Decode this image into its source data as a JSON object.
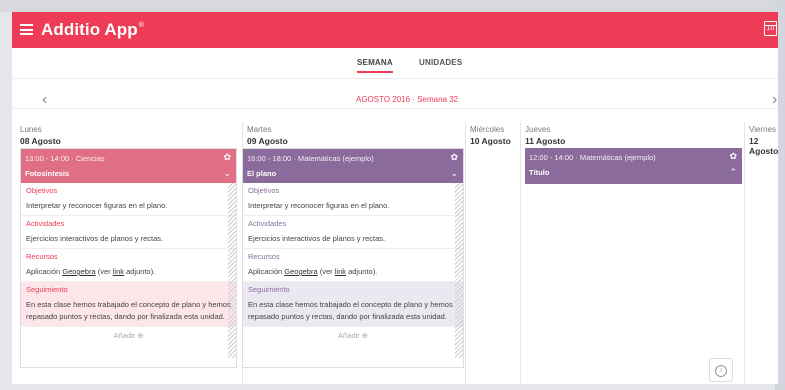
{
  "app": {
    "title": "Additio App",
    "trademark": "®",
    "calendar_badge": "10"
  },
  "tabs": [
    {
      "label": "SEMANA"
    },
    {
      "label": "UNIDADES"
    }
  ],
  "nav": {
    "prev": "‹",
    "next": "›",
    "period": "AGOSTO 2016 · Semana 32"
  },
  "days": [
    {
      "name": "Lunes",
      "date": "08 Agosto"
    },
    {
      "name": "Martes",
      "date": "09 Agosto"
    },
    {
      "name": "Miércoles",
      "date": "10 Agosto"
    },
    {
      "name": "Jueves",
      "date": "11 Agosto"
    },
    {
      "name": "Viernes",
      "date": "12 Agosto"
    }
  ],
  "cards": [
    {
      "time": "13:00 - 14:00  ·  Ciencias",
      "subtitle": "Fotosíntesis",
      "color": "#e06e85",
      "objetivos_label": "Objetivos",
      "objetivos": "Interpretar y reconocer figuras en el plano.",
      "actividades_label": "Actividades",
      "actividades": "Ejercicios interactivos de planos y rectas.",
      "recursos_label": "Recursos",
      "recursos_pre": "Aplicación ",
      "recursos_link1": "Geogebra",
      "recursos_mid": " (ver ",
      "recursos_link2": "link",
      "recursos_post": " adjunto).",
      "seguimiento_label": "Seguimiento",
      "seguimiento": "En esta clase hemos trabajado el concepto de plano y hemos repasado puntos y rectas, dando por finalizada esta unidad.",
      "add_label": "Añadir ⊕"
    },
    {
      "time": "16:00 - 18:00  ·  Matemáticas (ejemplo)",
      "subtitle": "El plano",
      "color": "#8b6a9c",
      "objetivos_label": "Objetivos",
      "objetivos": "Interpretar y reconocer figuras en el plano.",
      "actividades_label": "Actividades",
      "actividades": "Ejercicios interactivos de planos y rectas.",
      "recursos_label": "Recursos",
      "recursos_pre": "Aplicación ",
      "recursos_link1": "Geogebra",
      "recursos_mid": " (ver ",
      "recursos_link2": "link",
      "recursos_post": " adjunto).",
      "seguimiento_label": "Seguimiento",
      "seguimiento": "En esta clase hemos trabajado el concepto de plano y hemos repasado puntos y rectas, dando por finalizada esta unidad.",
      "add_label": "Añadir ⊕"
    },
    {
      "time": "12:00 - 14:00  ·  Matemáticas (ejemplo)",
      "subtitle": "Título",
      "color": "#8b6a9c"
    }
  ],
  "icons": {
    "gear": "✿",
    "chevron_down": "⌄",
    "chevron_up": "⌃",
    "info": "i"
  },
  "colors": {
    "brand": "#ee3c56",
    "ciencias": "#e06e85",
    "matematicas": "#8b6a9c"
  }
}
